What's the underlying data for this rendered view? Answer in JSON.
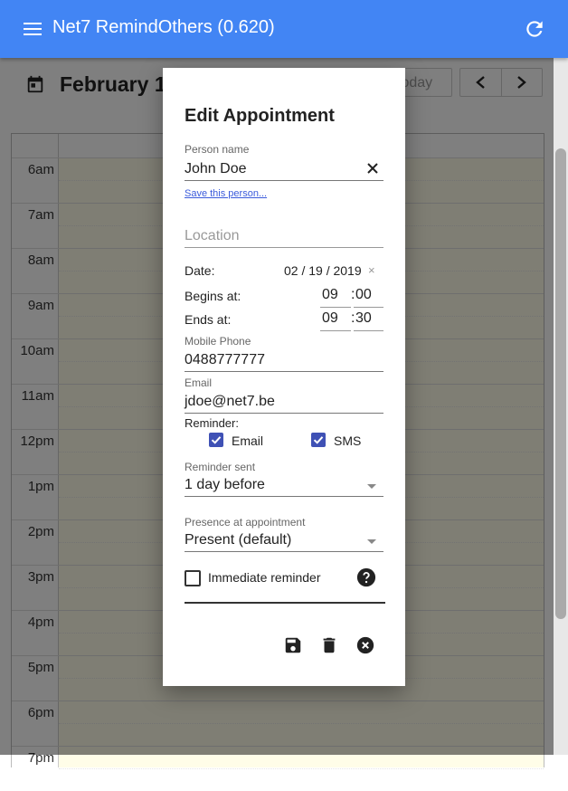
{
  "app": {
    "title": "Net7 RemindOthers (0.620)"
  },
  "calendar": {
    "month_label": "February 1",
    "today_label": "today",
    "hours": [
      "6am",
      "7am",
      "8am",
      "9am",
      "10am",
      "11am",
      "12pm",
      "1pm",
      "2pm",
      "3pm",
      "4pm",
      "5pm",
      "6pm",
      "7pm"
    ]
  },
  "dialog": {
    "title": "Edit Appointment",
    "person": {
      "label": "Person name",
      "value": "John Doe",
      "save_link": "Save this person..."
    },
    "location": {
      "placeholder": "Location"
    },
    "date": {
      "label": "Date:",
      "value": "02 / 19 / 2019"
    },
    "begins": {
      "label": "Begins at:",
      "hour": "09",
      "minute": "00"
    },
    "ends": {
      "label": "Ends at:",
      "hour": "09",
      "minute": "30"
    },
    "mobile": {
      "label": "Mobile Phone",
      "value": "0488777777"
    },
    "email": {
      "label": "Email",
      "value": "jdoe@net7.be"
    },
    "reminder": {
      "label": "Reminder:",
      "email_label": "Email",
      "sms_label": "SMS",
      "email_checked": true,
      "sms_checked": true
    },
    "reminder_sent": {
      "label": "Reminder sent",
      "value": "1 day before"
    },
    "presence": {
      "label": "Presence at appointment",
      "value": "Present (default)"
    },
    "immediate": {
      "label": "Immediate reminder",
      "checked": false
    }
  },
  "colors": {
    "appbar": "#4285f4",
    "accent": "#3f51b5",
    "link": "#3b5bdb",
    "today_bg": "#fffde8"
  },
  "icons": [
    "menu-icon",
    "refresh-icon",
    "calendar-icon",
    "chevron-left-icon",
    "chevron-right-icon",
    "clear-icon",
    "help-icon",
    "save-icon",
    "delete-icon",
    "close-icon"
  ]
}
